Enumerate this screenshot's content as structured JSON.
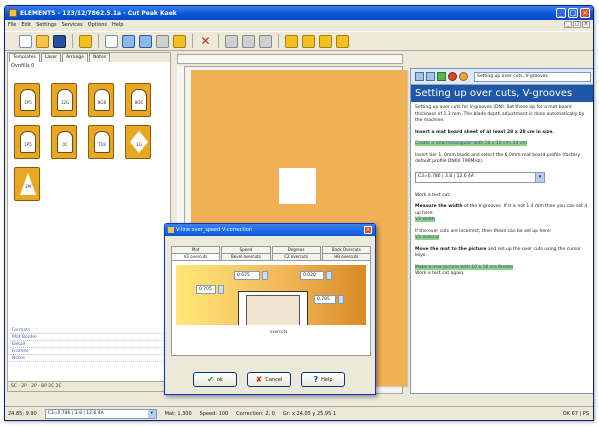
{
  "window": {
    "title": "ELEMENTS - 123/12/7862.5.1a - Cut Peak Kaek"
  },
  "menu": [
    "File",
    "Edit",
    "Settings",
    "Services",
    "Options",
    "Help"
  ],
  "left_panel": {
    "tabs": [
      "Templates",
      "Laser",
      "Arrange",
      "Notes"
    ],
    "section_label": "Ovnfills 0",
    "templates": [
      {
        "label": "1P5",
        "shape": "arch"
      },
      {
        "label": "12G",
        "shape": "arch"
      },
      {
        "label": "8G8",
        "shape": "arch"
      },
      {
        "label": "8OC",
        "shape": "arch"
      },
      {
        "label": "1P5",
        "shape": "arch"
      },
      {
        "label": "0C",
        "shape": "arch"
      },
      {
        "label": "T18",
        "shape": "arch"
      },
      {
        "label": "1G",
        "shape": "diamond"
      },
      {
        "label": "1M",
        "shape": "tri"
      }
    ],
    "tree": [
      "Formats",
      "Mat Border",
      "Detail",
      "Frames",
      "Notes"
    ],
    "bottom_bar": "SC · 2P · 2P · BP 2C 2C ·"
  },
  "right_panel": {
    "select": "Setting up over cuts, V-grooves",
    "heading": "Setting up over cuts, V-grooves",
    "intro": "Setting up over cuts for V-grooves (DN). Set these up for a mat board thickness of 1.3 mm. The blade depth adjustment is done automatically by the machine.",
    "step1": "Insert a mat board sheet of at least 28 x 28 cm in size.",
    "step1_hl": "Create a new rectangular with 10 x 10 cm, 24 cm",
    "step2": "Insert tier 1, 0mm blade and select the 6.0mm mat board profile (factory default profile DN60 796MHz).",
    "combo": "C3=0.786 | 3.8 | 12.6 4A",
    "step3": "Work a test cut.",
    "step4_a": "Measure the ",
    "step4_b": "width",
    "step4_c": " of the V-grooves. If it is not 1.4 mm then you can set it up here:",
    "step4_link": "V2 width",
    "step5": "If the over cuts are incorrect, then these can be set up here:",
    "step5_link": "V2 overcut",
    "step6_a": "Move the mat ",
    "step6_b": "to the picture",
    "step6_c": " and set up the over cuts using the cursor keys.",
    "step6_hl": "Make a new picture with 10 x 10 cm Breaks",
    "step7": "Work a test cut again."
  },
  "status": {
    "coords": "24.85; 9.90",
    "profile": "C3=0.786 | 3.8 | 12.6 4A",
    "mat": "Mat: 1.300",
    "speed": "Speed: 100",
    "correction": "Correction: 2, 0",
    "size": "Gr: x 24.05 y 25.95 1",
    "right": "OK 67 | PS"
  },
  "dialog": {
    "title": "V-line over_speed V-correction",
    "tabs_row1": [
      "Mat",
      "Speed",
      "Degrees",
      "Back Overcuts"
    ],
    "tabs_row2": [
      "V2 overcuts",
      "Bevel overcuts",
      "C2 overcuts",
      "HB overcuts"
    ],
    "value_top": "0.675",
    "value_right": "0.020",
    "value_left": "0.705",
    "value_bottom": "0.785",
    "caption": "overcuts",
    "buttons": {
      "ok": "ok",
      "cancel": "Cancel",
      "help": "Help"
    }
  },
  "colors": {
    "board": "#f0b054",
    "accent": "#1d57a6",
    "title": "#0a58d8"
  }
}
